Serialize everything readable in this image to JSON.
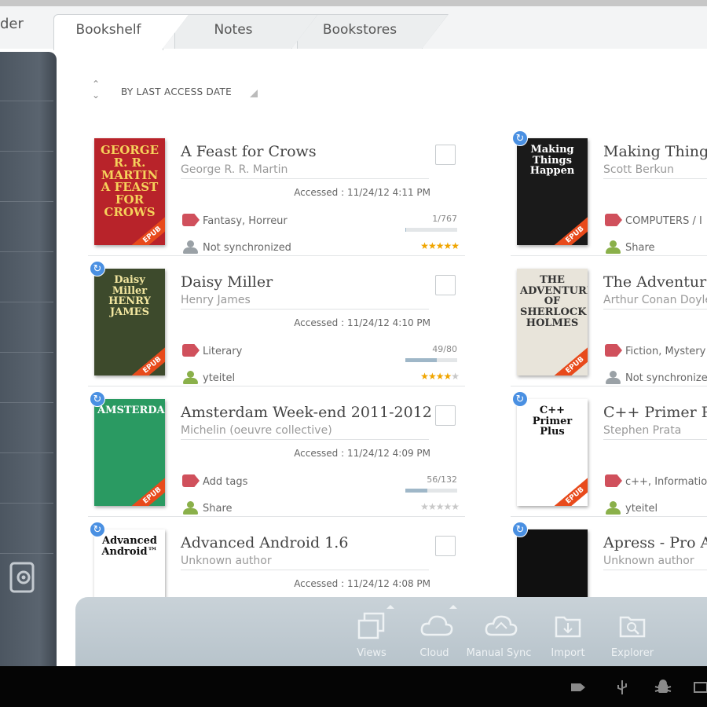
{
  "app": {
    "title_fragment": "der"
  },
  "tabs": [
    {
      "label": "Bookshelf",
      "active": true
    },
    {
      "label": "Notes",
      "active": false
    },
    {
      "label": "Bookstores",
      "active": false
    }
  ],
  "sort": {
    "label": "BY LAST ACCESS DATE"
  },
  "books_left": [
    {
      "title": "A Feast for Crows",
      "author": "George R. R. Martin",
      "accessed": "Accessed : 11/24/12 4:11 PM",
      "tags": "Fantasy, Horreur",
      "progress_text": "1/767",
      "progress": 0.01,
      "sync_status": "Not synchronized",
      "rating": 5,
      "synced_badge": false,
      "cover": {
        "text": "GEORGE R. R. MARTIN A FEAST FOR CROWS",
        "bg": "#b8232a",
        "fg": "#f6d25b"
      }
    },
    {
      "title": "Daisy Miller",
      "author": "Henry James",
      "accessed": "Accessed : 11/24/12 4:10 PM",
      "tags": "Literary",
      "progress_text": "49/80",
      "progress": 0.61,
      "sync_status": "yteitel",
      "rating": 4,
      "synced_badge": true,
      "cover": {
        "text": "Daisy Miller HENRY JAMES",
        "bg": "#3d4a2c",
        "fg": "#f3e7a0"
      }
    },
    {
      "title": "Amsterdam Week-end 2011-2012",
      "author": "Michelin (oeuvre collective)",
      "accessed": "Accessed : 11/24/12 4:09 PM",
      "tags": "Add tags",
      "progress_text": "56/132",
      "progress": 0.42,
      "sync_status": "Share",
      "rating": 0,
      "synced_badge": true,
      "cover": {
        "text": "AMSTERDAM",
        "bg": "#2a9a62",
        "fg": "#ffffff"
      }
    },
    {
      "title": "Advanced Android 1.6",
      "author": "Unknown author",
      "accessed": "Accessed : 11/24/12 4:08 PM",
      "tags": "",
      "progress_text": "",
      "progress": 0,
      "sync_status": "",
      "rating": 0,
      "synced_badge": true,
      "cover": {
        "text": "Advanced Android™",
        "bg": "#ffffff",
        "fg": "#111111"
      }
    }
  ],
  "books_right": [
    {
      "title": "Making Things",
      "author": "Scott Berkun",
      "tags": "COMPUTERS / I",
      "sync_status": "Share",
      "synced_badge": true,
      "cover": {
        "text": "Making Things Happen",
        "bg": "#1a1a1a",
        "fg": "#ffffff"
      }
    },
    {
      "title": "The Adventure",
      "author": "Arthur Conan Doyle",
      "tags": "Fiction, Mystery",
      "sync_status": "Not synchronize",
      "synced_badge": false,
      "cover": {
        "text": "THE ADVENTURES OF SHERLOCK HOLMES",
        "bg": "#e8e4da",
        "fg": "#333333"
      }
    },
    {
      "title": "C++ Primer Plu",
      "author": "Stephen Prata",
      "tags": "c++, Informatio",
      "sync_status": "yteitel",
      "synced_badge": true,
      "cover": {
        "text": "C++ Primer Plus",
        "bg": "#ffffff",
        "fg": "#111111"
      }
    },
    {
      "title": "Apress - Pro Ar",
      "author": "Unknown author",
      "tags": "",
      "sync_status": "",
      "synced_badge": true,
      "cover": {
        "text": "",
        "bg": "#101010",
        "fg": "#ffffff"
      }
    }
  ],
  "bottom_bar": {
    "buttons": [
      {
        "label": "Views",
        "icon": "views-icon",
        "menu": true
      },
      {
        "label": "Cloud",
        "icon": "cloud-icon",
        "menu": true
      },
      {
        "label": "Manual Sync",
        "icon": "manual-sync-icon",
        "menu": false
      },
      {
        "label": "Import",
        "icon": "import-icon",
        "menu": false
      },
      {
        "label": "Explorer",
        "icon": "explorer-icon",
        "menu": false
      }
    ]
  },
  "colors": {
    "sidebar": "#4c5661",
    "tag": "#d0505c",
    "star": "#f0a500",
    "sync_badge": "#4a90e2",
    "epub_ribbon": "#e84a1b"
  }
}
